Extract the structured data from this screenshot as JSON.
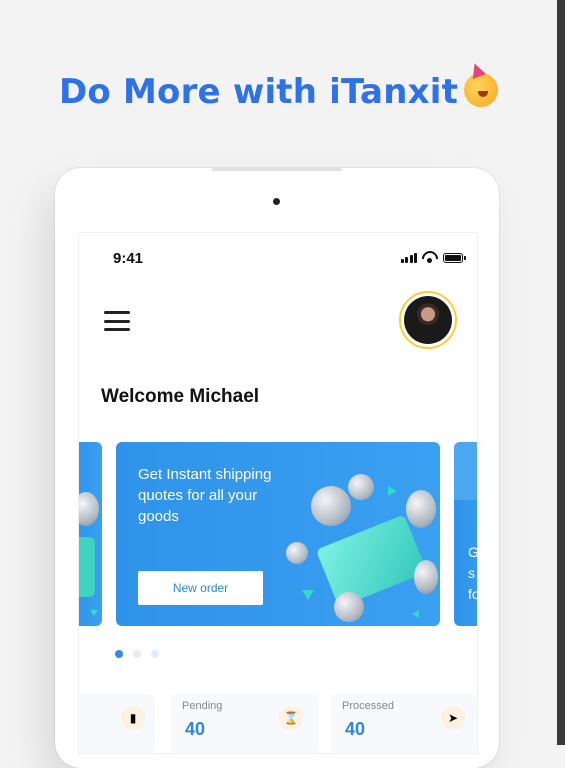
{
  "headline": "Do More with iTanxit",
  "headline_emoji": "partying-face-icon",
  "status_bar": {
    "time": "9:41"
  },
  "header": {
    "menu_icon": "hamburger-menu-icon",
    "avatar": "user-avatar"
  },
  "welcome": "Welcome Michael",
  "carousel": {
    "active_index": 0,
    "slide_count": 3,
    "main_card": {
      "text": "Get Instant shipping quotes for all your goods",
      "button_label": "New order"
    },
    "peek_card_text": "G\ns\nfo"
  },
  "stats": [
    {
      "label": "Pending",
      "value": "40",
      "icon": "hourglass-icon"
    },
    {
      "label": "Processed",
      "value": "40",
      "icon": "rocket-icon"
    }
  ],
  "colors": {
    "accent": "#2f86e0",
    "card_blue": "#3aa0f0",
    "avatar_ring": "#f5d038"
  }
}
